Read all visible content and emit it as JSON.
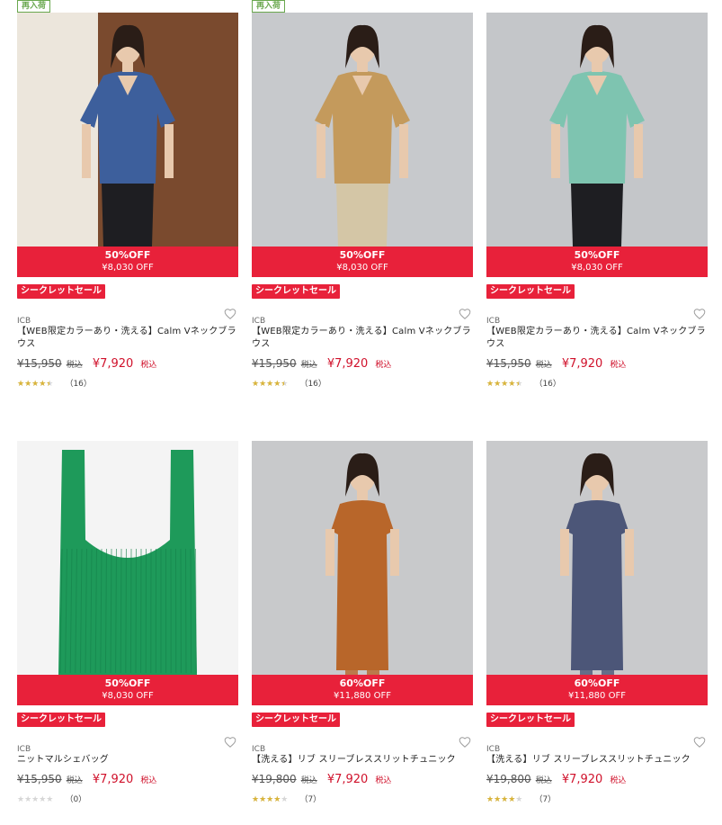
{
  "products": [
    {
      "restock": "再入荷",
      "discount_pct": "50%OFF",
      "discount_amt": "¥8,030 OFF",
      "badge": "シークレットセール",
      "brand": "ICB",
      "name": "【WEB限定カラーあり・洗える】Calm Vネックブラウス",
      "orig_price": "¥15,950",
      "orig_tax": "税込",
      "sale_price": "¥7,920",
      "sale_tax": "税込",
      "rating": 4.5,
      "review_count": "（16）",
      "colors": {
        "bg": "#7a4a2e",
        "item": "#3d5f9c"
      }
    },
    {
      "restock": "再入荷",
      "discount_pct": "50%OFF",
      "discount_amt": "¥8,030 OFF",
      "badge": "シークレットセール",
      "brand": "ICB",
      "name": "【WEB限定カラーあり・洗える】Calm Vネックブラウス",
      "orig_price": "¥15,950",
      "orig_tax": "税込",
      "sale_price": "¥7,920",
      "sale_tax": "税込",
      "rating": 4.5,
      "review_count": "（16）",
      "colors": {
        "bg": "#c7c9cc",
        "item": "#c49a5c"
      }
    },
    {
      "restock": "",
      "discount_pct": "50%OFF",
      "discount_amt": "¥8,030 OFF",
      "badge": "シークレットセール",
      "brand": "ICB",
      "name": "【WEB限定カラーあり・洗える】Calm Vネックブラウス",
      "orig_price": "¥15,950",
      "orig_tax": "税込",
      "sale_price": "¥7,920",
      "sale_tax": "税込",
      "rating": 4.5,
      "review_count": "（16）",
      "colors": {
        "bg": "#c4c6c9",
        "item": "#7ec4b0"
      }
    },
    {
      "restock": "",
      "discount_pct": "50%OFF",
      "discount_amt": "¥8,030 OFF",
      "badge": "シークレットセール",
      "brand": "ICB",
      "name": "ニットマルシェバッグ",
      "orig_price": "¥15,950",
      "orig_tax": "税込",
      "sale_price": "¥7,920",
      "sale_tax": "税込",
      "rating": 0,
      "review_count": "（0）",
      "colors": {
        "bg": "#f4f4f4",
        "item": "#1e9a5a"
      }
    },
    {
      "restock": "",
      "discount_pct": "60%OFF",
      "discount_amt": "¥11,880 OFF",
      "badge": "シークレットセール",
      "brand": "ICB",
      "name": "【洗える】リブ スリーブレススリットチュニック",
      "orig_price": "¥19,800",
      "orig_tax": "税込",
      "sale_price": "¥7,920",
      "sale_tax": "税込",
      "rating": 4,
      "review_count": "（7）",
      "colors": {
        "bg": "#c8c9cb",
        "item": "#b8662a"
      }
    },
    {
      "restock": "",
      "discount_pct": "60%OFF",
      "discount_amt": "¥11,880 OFF",
      "badge": "シークレットセール",
      "brand": "ICB",
      "name": "【洗える】リブ スリーブレススリットチュニック",
      "orig_price": "¥19,800",
      "orig_tax": "税込",
      "sale_price": "¥7,920",
      "sale_tax": "税込",
      "rating": 4,
      "review_count": "（7）",
      "colors": {
        "bg": "#c9cacc",
        "item": "#4c5678"
      }
    }
  ]
}
